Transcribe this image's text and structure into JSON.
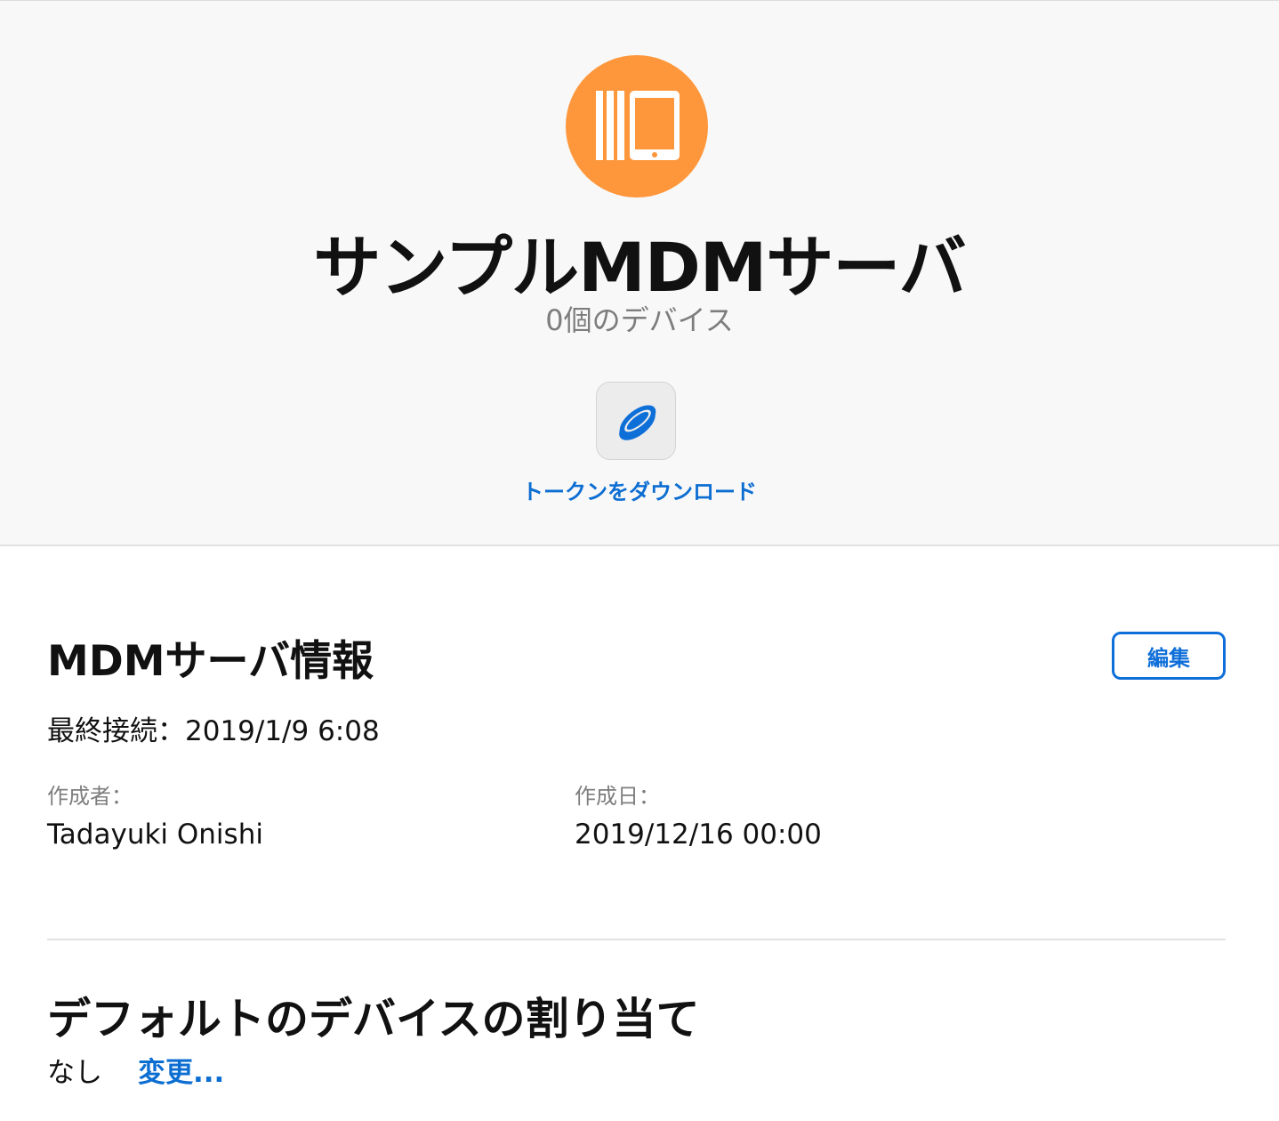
{
  "header": {
    "server_name": "サンプルMDMサーバ",
    "device_count": "0個のデバイス",
    "token_action_label": "トークンをダウンロード",
    "accent_color": "#fe973c",
    "link_color": "#0d6ed2",
    "server_icon": "device-stack-icon",
    "token_icon": "token-coin-icon"
  },
  "info": {
    "title": "MDMサーバ情報",
    "edit_label": "編集",
    "last_connection": "最終接続：2019/1/9 6:08",
    "created_by_label": "作成者：",
    "created_by_value": "Tadayuki Onishi",
    "created_date_label": "作成日：",
    "created_date_value": "2019/12/16 00:00"
  },
  "assignment": {
    "title": "デフォルトのデバイスの割り当て",
    "value": "なし",
    "change_label": "変更..."
  }
}
